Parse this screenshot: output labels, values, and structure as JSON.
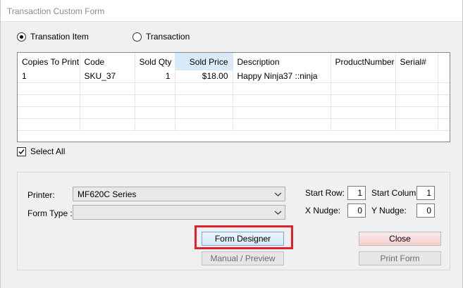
{
  "window": {
    "title": "Transaction Custom Form"
  },
  "mode": {
    "options": [
      {
        "label": "Transation Item",
        "selected": true
      },
      {
        "label": "Transaction",
        "selected": false
      }
    ]
  },
  "grid": {
    "columns": [
      "Copies To Print",
      "Code",
      "Sold Qty",
      "Sold Price",
      "Description",
      "ProductNumber",
      "Serial#"
    ],
    "rows": [
      [
        "1",
        "SKU_37",
        "1",
        "$18.00",
        "Happy Ninja37 ::ninja",
        "",
        ""
      ]
    ]
  },
  "select_all": {
    "label": "Select All",
    "checked": true
  },
  "printer": {
    "label": "Printer:",
    "value": "MF620C Series"
  },
  "form_type": {
    "label": "Form Type :",
    "value": ""
  },
  "start_row": {
    "label": "Start Row:",
    "value": "1"
  },
  "start_column": {
    "label": "Start Column:",
    "value": "1"
  },
  "x_nudge": {
    "label": "X Nudge:",
    "value": "0"
  },
  "y_nudge": {
    "label": "Y Nudge:",
    "value": "0"
  },
  "buttons": {
    "form_designer": "Form Designer",
    "manual_preview": "Manual / Preview",
    "close": "Close",
    "print_form": "Print Form"
  },
  "colors": {
    "highlight": "#e0202a",
    "sorted_header": "#d9ebf9"
  }
}
